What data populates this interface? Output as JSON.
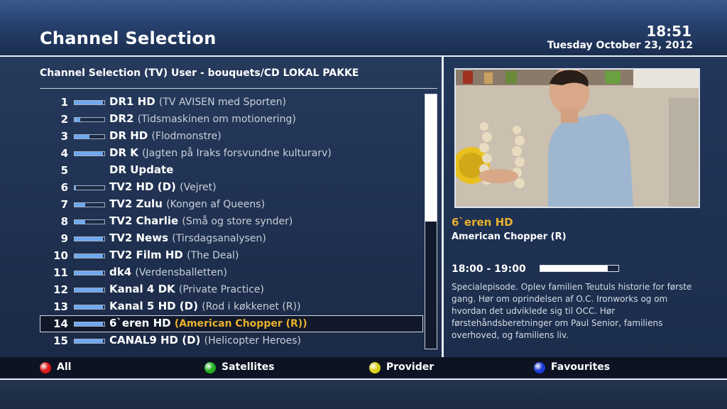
{
  "header": {
    "title": "Channel Selection",
    "time": "18:51",
    "date": "Tuesday October 23, 2012"
  },
  "list": {
    "header": "Channel Selection (TV) User - bouquets/CD LOKAL PAKKE",
    "selected_index": 13,
    "channels": [
      {
        "num": "1",
        "name": "DR1 HD",
        "program": "(TV AVISEN med Sporten)",
        "signal": 0.95
      },
      {
        "num": "2",
        "name": "DR2",
        "program": "(Tidsmaskinen om motionering)",
        "signal": 0.2
      },
      {
        "num": "3",
        "name": "DR HD",
        "program": "(Flodmonstre)",
        "signal": 0.5
      },
      {
        "num": "4",
        "name": "DR K",
        "program": "(Jagten på Iraks forsvundne kulturarv)",
        "signal": 0.95
      },
      {
        "num": "5",
        "name": "DR Update",
        "program": "",
        "signal": null
      },
      {
        "num": "6",
        "name": "TV2 HD (D)",
        "program": "(Vejret)",
        "signal": 0.05
      },
      {
        "num": "7",
        "name": "TV2 Zulu",
        "program": "(Kongen af Queens)",
        "signal": 0.35
      },
      {
        "num": "8",
        "name": "TV2 Charlie",
        "program": "(Små og store synder)",
        "signal": 0.35
      },
      {
        "num": "9",
        "name": "TV2 News",
        "program": "(Tirsdagsanalysen)",
        "signal": 0.95
      },
      {
        "num": "10",
        "name": "TV2 Film HD",
        "program": "(The Deal)",
        "signal": 0.95
      },
      {
        "num": "11",
        "name": "dk4",
        "program": "(Verdensballetten)",
        "signal": 0.95
      },
      {
        "num": "12",
        "name": "Kanal 4 DK",
        "program": "(Private Practice)",
        "signal": 0.95
      },
      {
        "num": "13",
        "name": "Kanal 5 HD (D)",
        "program": "(Rod i køkkenet (R))",
        "signal": 0.95
      },
      {
        "num": "14",
        "name": "6`eren HD",
        "program": "(American Chopper (R))",
        "signal": 0.95
      },
      {
        "num": "15",
        "name": "CANAL9 HD (D)",
        "program": "(Helicopter Heroes)",
        "signal": 0.95
      }
    ],
    "scroll_fraction": 0.5
  },
  "info": {
    "channel": "6`eren HD",
    "program": "American Chopper (R)",
    "time_range": "18:00 - 19:00",
    "progress": 0.86,
    "description": "Specialepisode. Oplev familien Teutuls historie for første gang. Hør om oprindelsen af O.C. Ironworks og om hvordan det udviklede sig til OCC. Hør førstehåndsberetninger om Paul Senior, familiens overhoved, og familiens liv."
  },
  "footer": {
    "buttons": [
      {
        "label": "All",
        "color": "#d81818"
      },
      {
        "label": "Satellites",
        "color": "#22b022"
      },
      {
        "label": "Provider",
        "color": "#d8d018"
      },
      {
        "label": "Favourites",
        "color": "#1a3ad8"
      }
    ]
  }
}
